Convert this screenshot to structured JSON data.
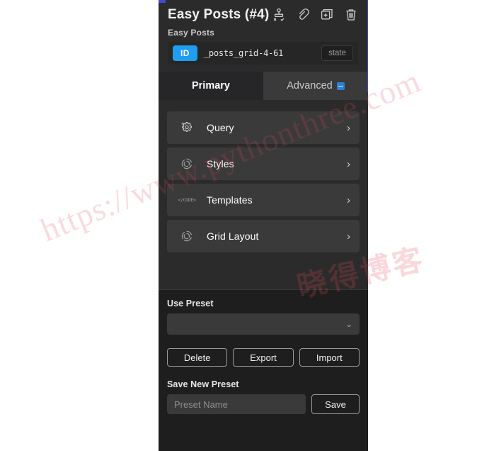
{
  "header": {
    "title": "Easy Posts (#4)",
    "subtitle": "Easy Posts",
    "icons": [
      {
        "name": "sitemap-icon",
        "label": "sitemap"
      },
      {
        "name": "link-icon",
        "label": "link"
      },
      {
        "name": "duplicate-icon",
        "label": "duplicate"
      },
      {
        "name": "trash-icon",
        "label": "delete"
      }
    ]
  },
  "id_bar": {
    "chip_label": "ID",
    "value": "_posts_grid-4-61",
    "state_label": "state"
  },
  "tabs": [
    {
      "label": "Primary",
      "active": true,
      "badge": false
    },
    {
      "label": "Advanced",
      "active": false,
      "badge": true
    }
  ],
  "menu_rows": [
    {
      "label": "Query",
      "icon": "gear-icon",
      "chevron": "›"
    },
    {
      "label": "Styles",
      "icon": "spinner-icon",
      "chevron": "›"
    },
    {
      "label": "Templates",
      "icon": "code-icon",
      "icon_text": "</CODE>",
      "chevron": "›"
    },
    {
      "label": "Grid Layout",
      "icon": "spinner-icon",
      "chevron": "›"
    }
  ],
  "preset": {
    "use_preset_label": "Use Preset",
    "selected_value": "",
    "chevron": "⌄",
    "buttons": [
      "Delete",
      "Export",
      "Import"
    ]
  },
  "save_preset": {
    "label": "Save New Preset",
    "input_value": "",
    "input_placeholder": "Preset Name",
    "save_label": "Save"
  },
  "watermark": {
    "url": "https://www.pythonthree.com",
    "cn": "晓得博客"
  },
  "colors": {
    "accent_blue": "#1e9df1",
    "panel_bg": "#2b2b2b",
    "row_bg": "#3a3a3a",
    "footer_bg": "#1e1e1e",
    "tabbar_bg": "#3a3a3a",
    "active_tab_bg": "#262628",
    "watermark_pink": "#e2485c"
  }
}
